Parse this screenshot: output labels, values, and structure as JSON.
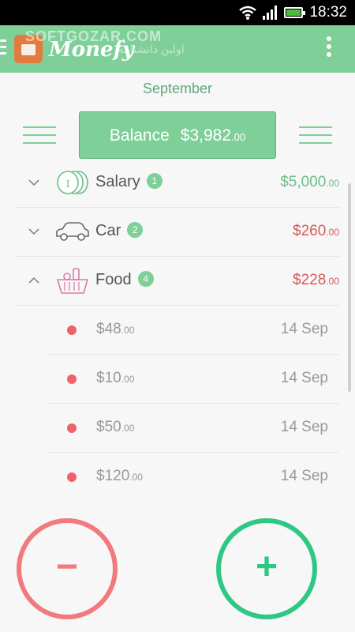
{
  "status_bar": {
    "time": "18:32"
  },
  "app_bar": {
    "title": "Monefy",
    "watermark": "SOFTGOZAR.COM",
    "watermark_sub": "اولین دانشنامه"
  },
  "month": "September",
  "balance": {
    "label": "Balance",
    "amount": "$3,982",
    "cents": ".00"
  },
  "categories": [
    {
      "name": "Salary",
      "badge": "1",
      "amount": "$5,000",
      "cents": ".00",
      "icon": "coins-icon",
      "expanded": false
    },
    {
      "name": "Car",
      "badge": "2",
      "amount": "$260",
      "cents": ".00",
      "icon": "car-icon",
      "expanded": false
    },
    {
      "name": "Food",
      "badge": "4",
      "amount": "$228",
      "cents": ".00",
      "icon": "basket-icon",
      "expanded": true
    }
  ],
  "food_entries": [
    {
      "amount": "$48",
      "cents": ".00",
      "date": "14 Sep"
    },
    {
      "amount": "$10",
      "cents": ".00",
      "date": "14 Sep"
    },
    {
      "amount": "$50",
      "cents": ".00",
      "date": "14 Sep"
    },
    {
      "amount": "$120",
      "cents": ".00",
      "date": "14 Sep"
    }
  ],
  "actions": {
    "minus": "−",
    "plus": "+"
  },
  "colors": {
    "accent": "#7fcf99",
    "income": "#6ebd8a",
    "expense": "#d65a5a",
    "minus_button": "#f07a7e",
    "plus_button": "#2ec883"
  }
}
